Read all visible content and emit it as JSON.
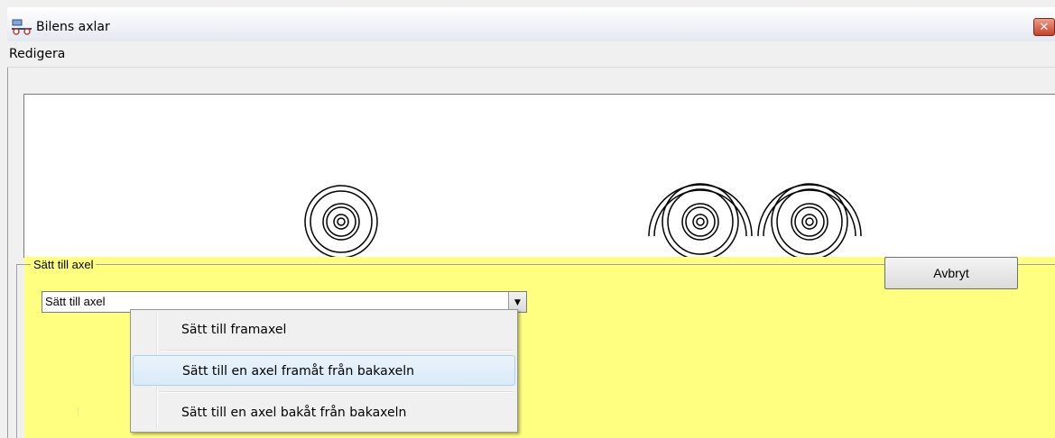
{
  "window": {
    "title": "Bilens axlar",
    "close_label": "✕"
  },
  "menu": {
    "items": [
      "Redigera"
    ]
  },
  "group": {
    "label": "Sätt till axel"
  },
  "buttons": {
    "cancel": "Avbryt"
  },
  "combo": {
    "value": "Sätt till axel"
  },
  "dropdown": {
    "items": [
      "Sätt till framaxel",
      "Sätt till en axel framåt från bakaxeln",
      "Sätt till en axel bakåt från bakaxeln"
    ],
    "highlighted_index": 1
  },
  "colors": {
    "panel": "#ffff80",
    "highlight": "#d9eaf8",
    "canvas": "#ffffff"
  }
}
